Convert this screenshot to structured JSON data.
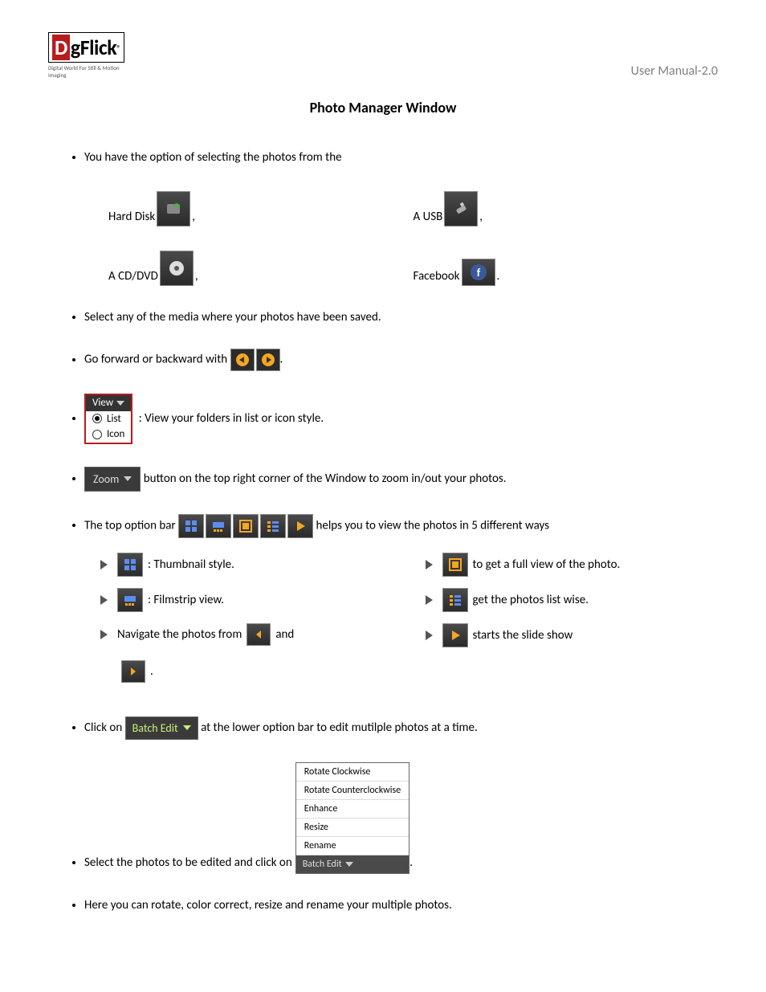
{
  "header": {
    "logo_text_d": "D",
    "logo_text_rest": "gFlick",
    "logo_r": "®",
    "logo_tag": "Digital World For Still & Motion Imaging",
    "manual": "User Manual-2.0"
  },
  "title": "Photo Manager Window",
  "bullets": {
    "b1": "You have the option of selecting the photos from the",
    "b2": "Select any of the media where your photos have been saved.",
    "b3a": "Go forward or backward with ",
    "b4": ": View your folders in list or icon style.",
    "b5a": " button on the top right corner of the Window to zoom in/out your photos.",
    "b6a": "The top option bar ",
    "b6b": " helps you to view the photos in 5 different ways",
    "b7a": "Click on ",
    "b7b": " at the lower option bar to edit mutilple photos at a time.",
    "b8a": "Select the photos to be edited and click on ",
    "b9": "Here you can rotate, color correct, resize and rename your multiple photos."
  },
  "sources": {
    "hd": "Hard Disk",
    "usb": "A USB",
    "cd": "A CD/DVD",
    "fb": "Facebook"
  },
  "view": {
    "head": "View",
    "opt1": "List",
    "opt2": "Icon"
  },
  "zoom": "Zoom",
  "subitems": {
    "left1": " : Thumbnail style.",
    "left2": ": Filmstrip view.",
    "left3a": "Navigate the photos from ",
    "left3b": " and",
    "right1": " to get a full view of the photo.",
    "right2": " get the photos list wise.",
    "right3": " starts the slide show"
  },
  "batch": "Batch Edit",
  "menu": {
    "m1": "Rotate Clockwise",
    "m2": "Rotate Counterclockwise",
    "m3": "Enhance",
    "m4": "Resize",
    "m5": "Rename",
    "trigger": "Batch Edit"
  },
  "punct": {
    "comma": ",",
    "period": "."
  }
}
